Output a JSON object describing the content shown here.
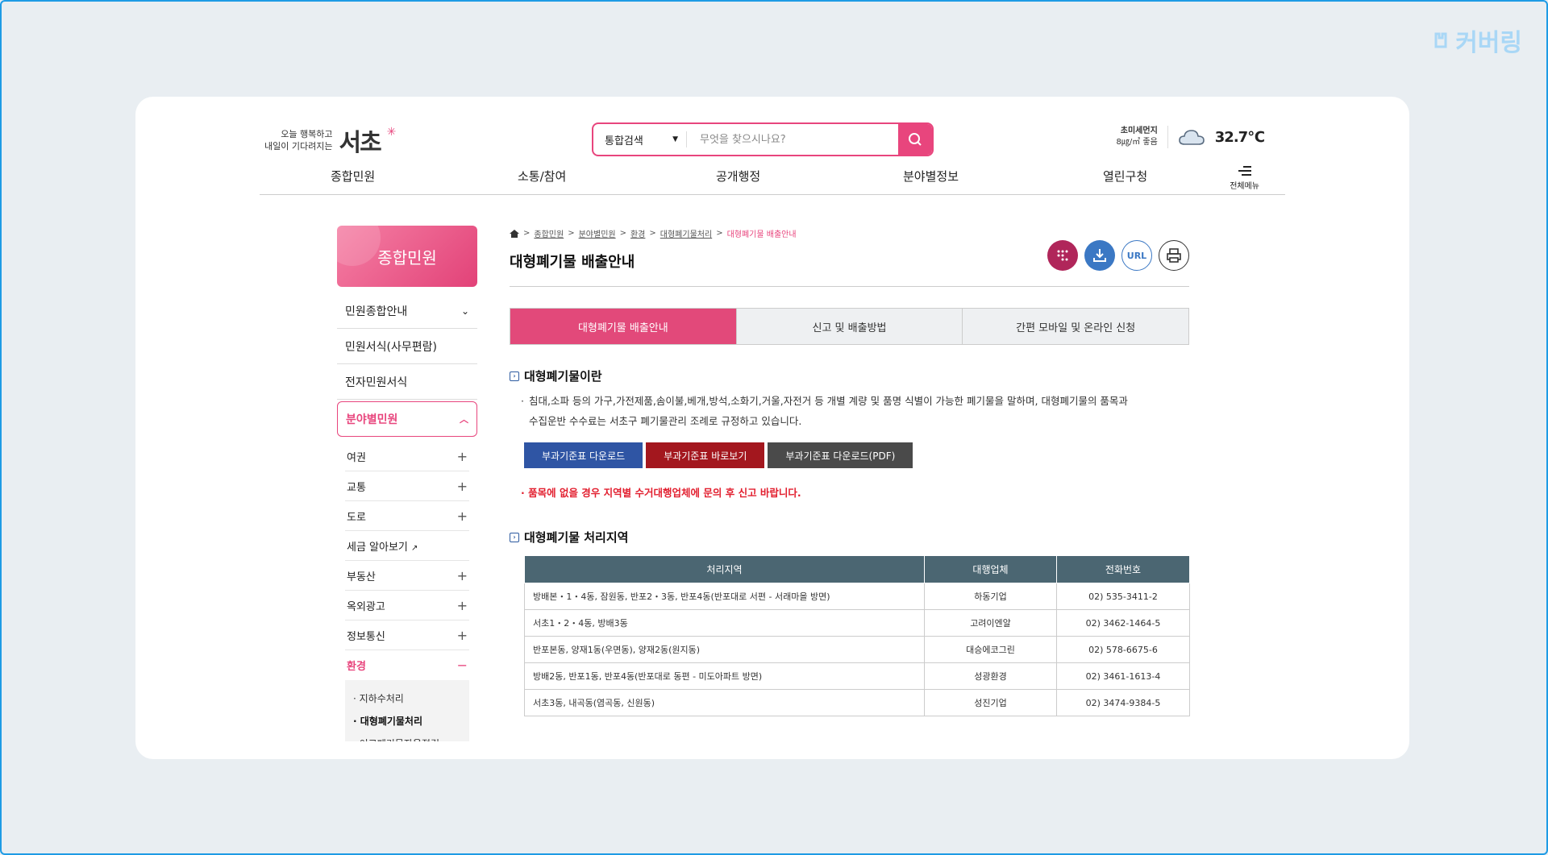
{
  "watermark": "커버링",
  "header": {
    "logo_tagline_1": "오늘 행복하고",
    "logo_tagline_2": "내일이 기다려지는",
    "logo_name": "서초",
    "search_type": "통합검색",
    "search_placeholder": "무엇을 찾으시나요?",
    "dust_label": "초미세먼지",
    "dust_value": "8㎍/㎥ 좋음",
    "temperature": "32.7℃",
    "allmenu_label": "전체메뉴"
  },
  "gnb": [
    "종합민원",
    "소통/참여",
    "공개행정",
    "분야별정보",
    "열린구청"
  ],
  "sidebar": {
    "title": "종합민원",
    "items": [
      {
        "label": "민원종합안내"
      },
      {
        "label": "민원서식(사무편람)"
      },
      {
        "label": "전자민원서식"
      },
      {
        "label": "분야별민원"
      }
    ],
    "sub_items": [
      {
        "label": "여권"
      },
      {
        "label": "교통"
      },
      {
        "label": "도로"
      },
      {
        "label": "세금 알아보기"
      },
      {
        "label": "부동산"
      },
      {
        "label": "옥외광고"
      },
      {
        "label": "정보통신"
      },
      {
        "label": "환경"
      }
    ],
    "sub_sub_items": [
      {
        "label": "· 지하수처리"
      },
      {
        "label": "· 대형폐기물처리"
      },
      {
        "label": "· 이코폐기물자율점검"
      }
    ]
  },
  "breadcrumb": [
    "종합민원",
    "분야별민원",
    "환경",
    "대형폐기물처리",
    "대형폐기물 배출안내"
  ],
  "page_title": "대형폐기물 배출안내",
  "tools": {
    "url_label": "URL"
  },
  "tabs": [
    "대형폐기물 배출안내",
    "신고 및 배출방법",
    "간편 모바일 및 온라인 신청"
  ],
  "section1": {
    "title": "대형폐기물이란",
    "desc_1": "침대,소파 등의 가구,가전제품,솜이불,베개,방석,소화기,거울,자전거 등 개별 계량 및 품명 식별이 가능한 폐기물을 말하며, 대형폐기물의 품목과",
    "desc_2": "수집운반 수수료는 서초구 폐기물관리 조례로 규정하고 있습니다.",
    "btn_download": "부과기준표 다운로드",
    "btn_view": "부과기준표 바로보기",
    "btn_pdf": "부과기준표 다운로드(PDF)",
    "warning": "· 품목에 없을 경우 지역별 수거대행업체에 문의 후 신고 바랍니다."
  },
  "section2": {
    "title": "대형폐기물 처리지역",
    "headers": [
      "처리지역",
      "대행업체",
      "전화번호"
    ],
    "rows": [
      [
        "방배본・1・4동, 잠원동, 반포2・3동, 반포4동(반포대로 서편 - 서래마을 방면)",
        "하동기업",
        "02) 535-3411-2"
      ],
      [
        "서초1・2・4동, 방배3동",
        "고려이엔알",
        "02) 3462-1464-5"
      ],
      [
        "반포본동, 양재1동(우면동), 양재2동(원지동)",
        "대승에코그린",
        "02) 578-6675-6"
      ],
      [
        "방배2동, 반포1동, 반포4동(반포대로 동편 - 미도아파트 방면)",
        "성광환경",
        "02) 3461-1613-4"
      ],
      [
        "서초3동, 내곡동(염곡동, 신원동)",
        "성진기업",
        "02) 3474-9384-5"
      ]
    ]
  },
  "colors": {
    "accent": "#e8457d",
    "table_header": "#4b6672",
    "btn_blue": "#2f55a4",
    "btn_red": "#a3171e",
    "btn_gray": "#4a4a4a",
    "warning": "#e21f2f"
  }
}
